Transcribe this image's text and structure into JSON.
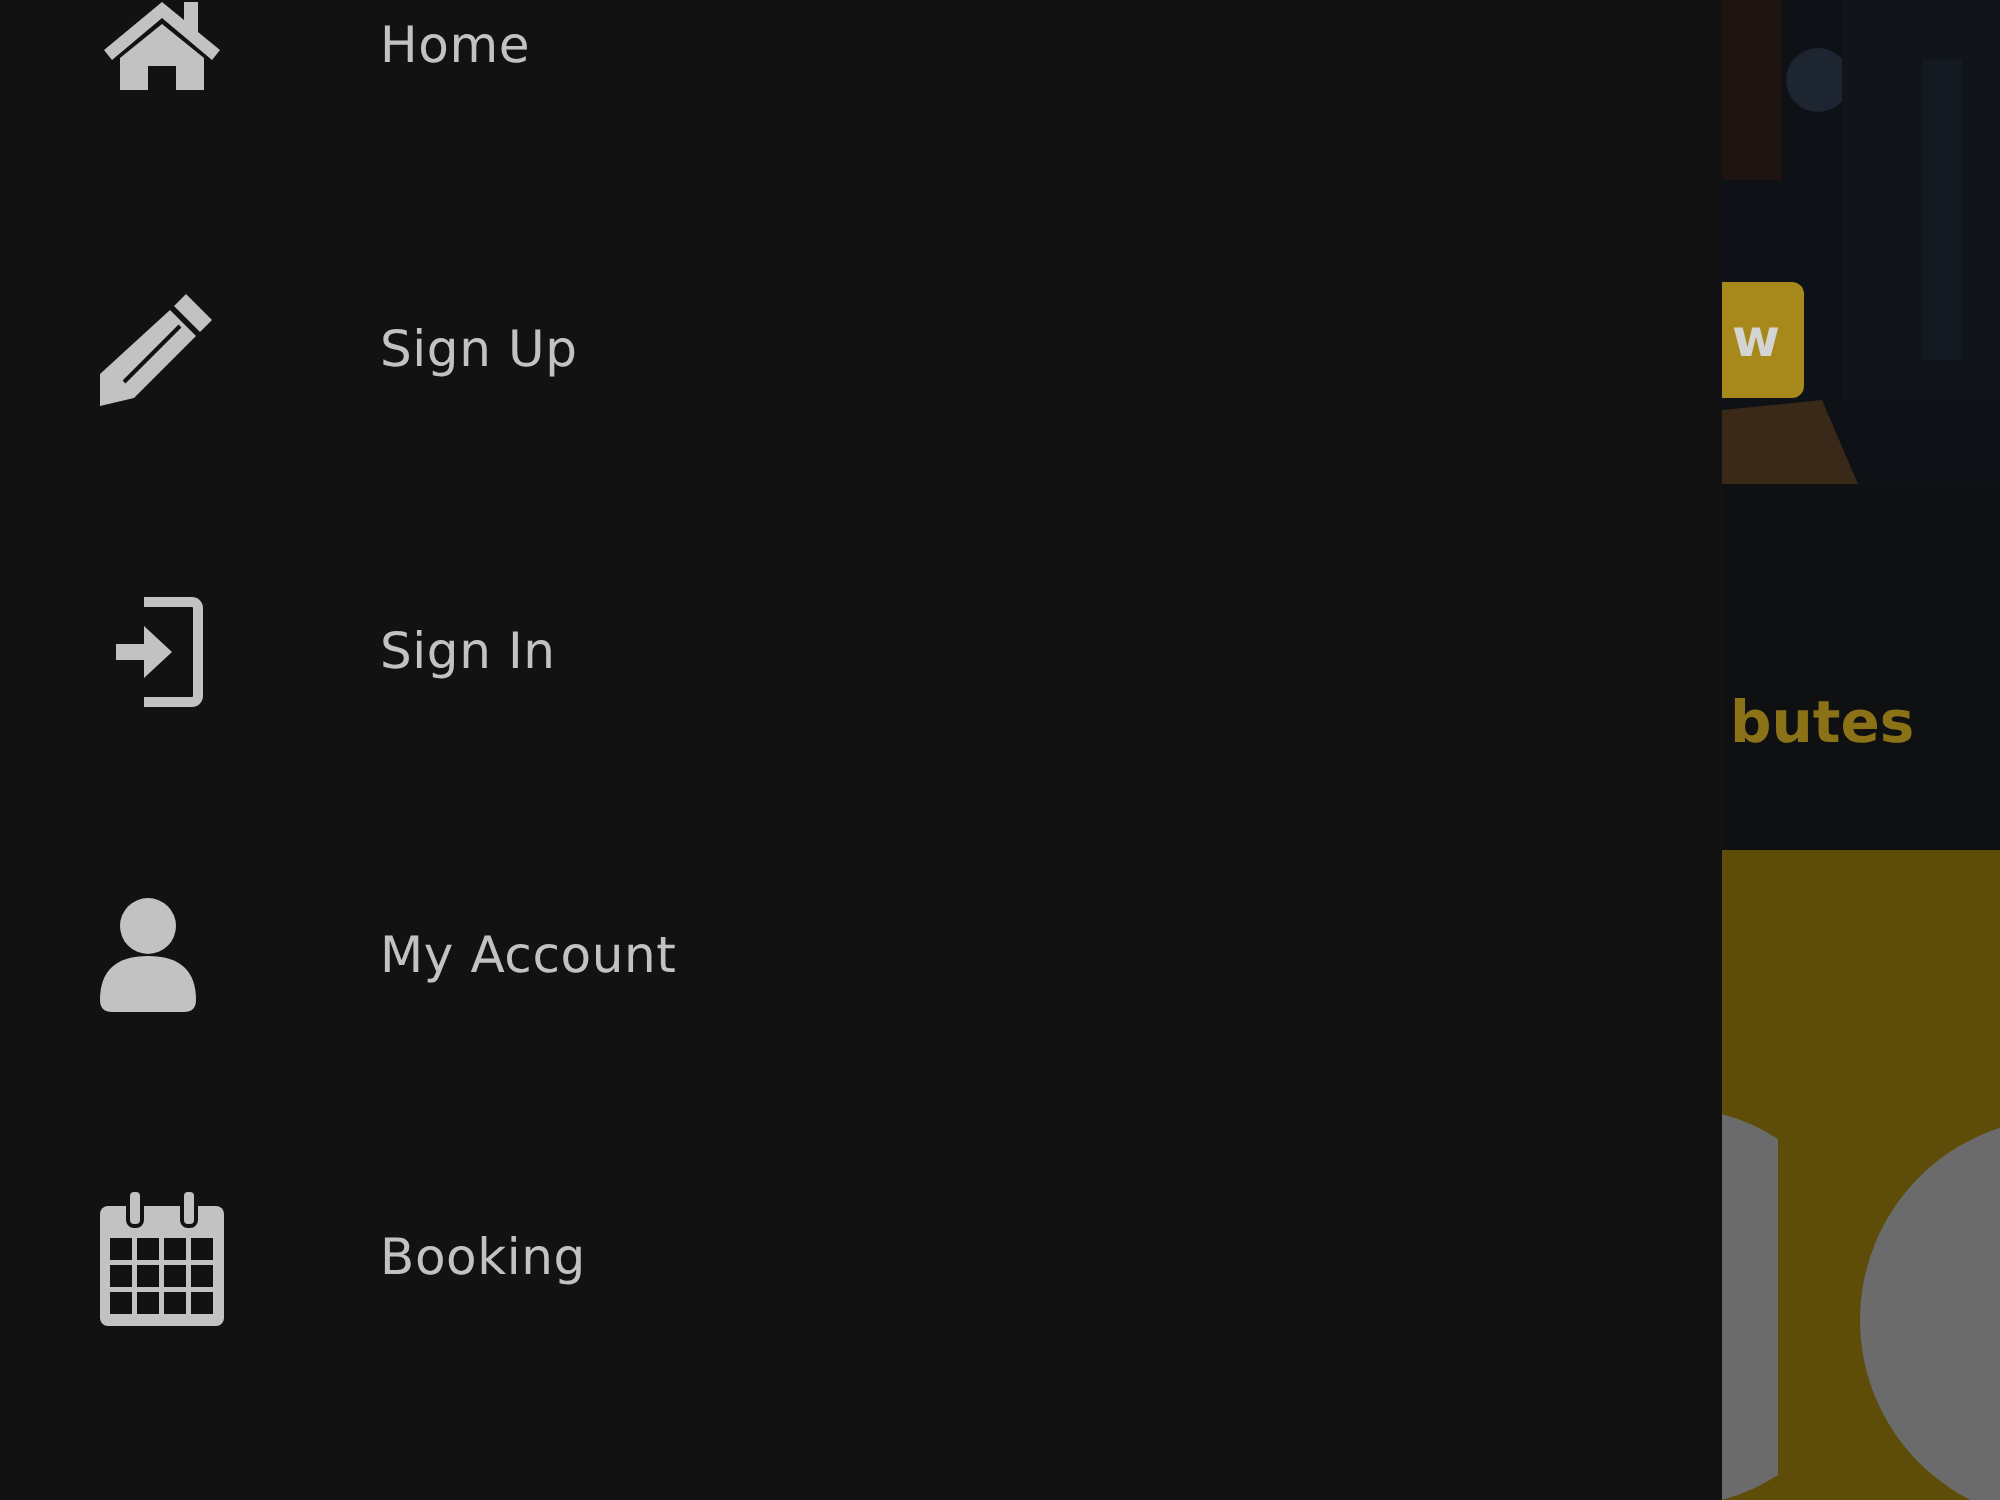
{
  "drawer": {
    "items": [
      {
        "label": "Home"
      },
      {
        "label": "Sign Up"
      },
      {
        "label": "Sign In"
      },
      {
        "label": "My Account"
      },
      {
        "label": "Booking"
      }
    ]
  },
  "page": {
    "hero": {
      "kind": "picture",
      "button": "w"
    },
    "heading": "butes"
  }
}
